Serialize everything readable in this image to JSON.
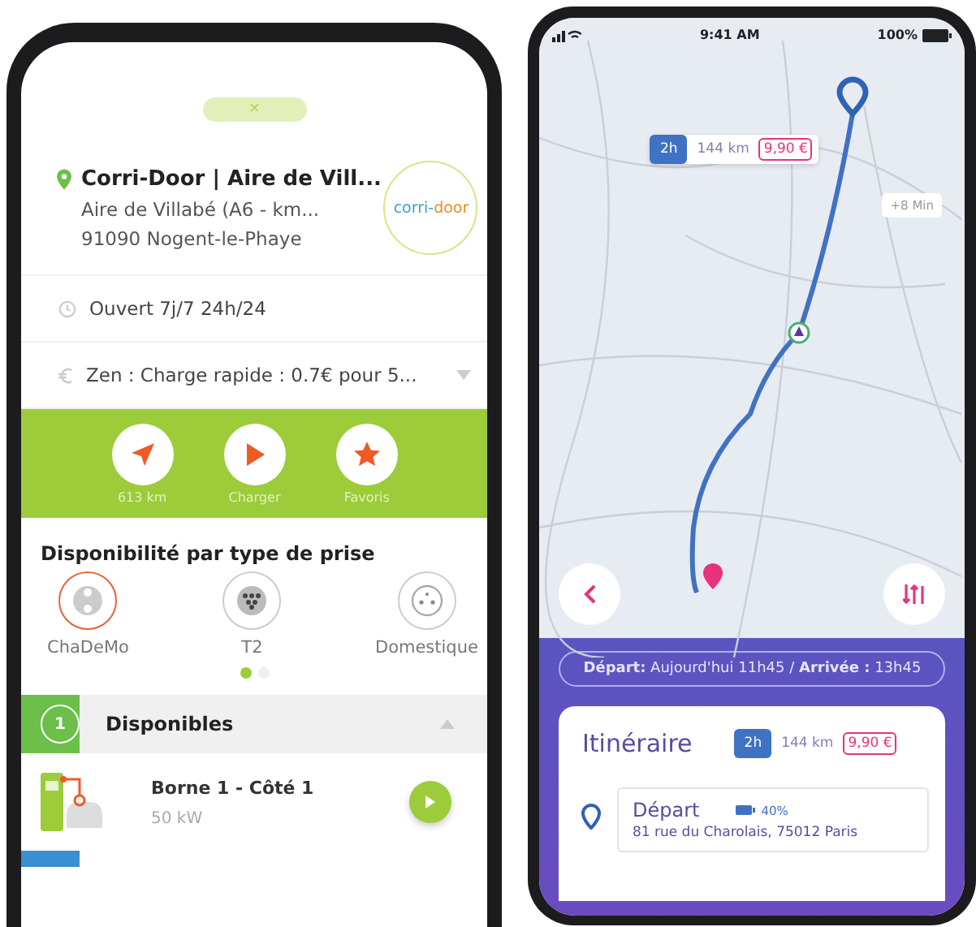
{
  "left_phone": {
    "close_button": "×",
    "station": {
      "name": "Corri-Door | Aire de Vill...",
      "address_1": "Aire de Villabé (A6 - km...",
      "address_2": "91090 Nogent-le-Phaye",
      "logo_text_1": "corri-",
      "logo_text_2": "door"
    },
    "hours": "Ouvert 7j/7 24h/24",
    "price": "Zen : Charge rapide : 0.7€ pour 5...",
    "actions": [
      {
        "kind": "navigate",
        "label": "613 km"
      },
      {
        "kind": "play",
        "label": "Charger"
      },
      {
        "kind": "star",
        "label": "Favoris"
      }
    ],
    "connectors_title": "Disponibilité par type de prise",
    "connectors": [
      {
        "kind": "chademo",
        "label": "ChaDeMo",
        "selected": true
      },
      {
        "kind": "t2",
        "label": "T2",
        "selected": false
      },
      {
        "kind": "domestic",
        "label": "Domestique",
        "selected": false
      }
    ],
    "pager": [
      {
        "selected": true
      },
      {
        "selected": false
      }
    ],
    "available": {
      "count": "1",
      "title": "Disponibles",
      "expanded": true
    },
    "stations": [
      {
        "name": "Borne 1 - Côté 1",
        "power": "50 kW"
      }
    ]
  },
  "right_phone": {
    "status_bar": {
      "time": "9:41 AM",
      "battery": "100%"
    },
    "map_route_chip": {
      "duration": "2h",
      "distance": "144 km",
      "price": "9,90 €"
    },
    "map_delay_chip": "+8 Min",
    "schedule": "**Départ:** Aujourd'hui 11h45 / **Arrivée :** 13h45",
    "itinerary": {
      "title": "Itinéraire",
      "duration": "2h",
      "distance": "144 km",
      "price": "9,90 €",
      "start": {
        "label": "Départ",
        "battery": "40%",
        "address": "81 rue du Charolais, 75012 Paris"
      }
    }
  }
}
